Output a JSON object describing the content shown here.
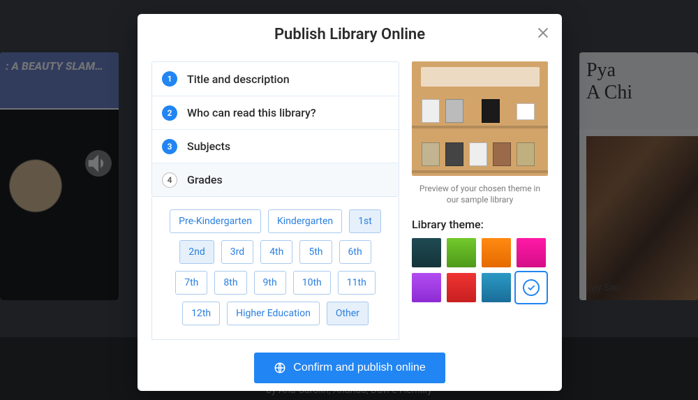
{
  "background": {
    "left_card": {
      "banner": ": A BEAUTY SLAM…"
    },
    "right_card": {
      "title_line1": "Pya",
      "title_line2": "A Chi",
      "author": "Lyly San"
    },
    "bottom_caption": "by Ana Carolin, Ananda, Davi e Hemilly"
  },
  "modal": {
    "title": "Publish Library Online",
    "steps": [
      {
        "num": "1",
        "label": "Title and description",
        "active": false,
        "done": true
      },
      {
        "num": "2",
        "label": "Who can read this library?",
        "active": false,
        "done": true
      },
      {
        "num": "3",
        "label": "Subjects",
        "active": false,
        "done": true
      },
      {
        "num": "4",
        "label": "Grades",
        "active": true,
        "done": false
      }
    ],
    "grades": [
      {
        "label": "Pre-Kindergarten",
        "selected": false
      },
      {
        "label": "Kindergarten",
        "selected": false
      },
      {
        "label": "1st",
        "selected": true
      },
      {
        "label": "2nd",
        "selected": true
      },
      {
        "label": "3rd",
        "selected": false
      },
      {
        "label": "4th",
        "selected": false
      },
      {
        "label": "5th",
        "selected": false
      },
      {
        "label": "6th",
        "selected": false
      },
      {
        "label": "7th",
        "selected": false
      },
      {
        "label": "8th",
        "selected": false
      },
      {
        "label": "9th",
        "selected": false
      },
      {
        "label": "10th",
        "selected": false
      },
      {
        "label": "11th",
        "selected": false
      },
      {
        "label": "12th",
        "selected": false
      },
      {
        "label": "Higher Education",
        "selected": false
      },
      {
        "label": "Other",
        "selected": true
      }
    ],
    "preview_caption": "Preview of your chosen theme in our sample library",
    "theme_label": "Library theme:",
    "themes": [
      {
        "name": "teal-dark",
        "css": "linear-gradient(#1f4a52,#14343a)",
        "selected": false
      },
      {
        "name": "green",
        "css": "linear-gradient(#72c92b,#4e9a1a)",
        "selected": false
      },
      {
        "name": "orange",
        "css": "linear-gradient(#ff8a12,#e56a00)",
        "selected": false
      },
      {
        "name": "magenta",
        "css": "linear-gradient(#ff1aa6,#d50d88)",
        "selected": false
      },
      {
        "name": "purple",
        "css": "linear-gradient(#b24cf0,#8d2cd4)",
        "selected": false
      },
      {
        "name": "red",
        "css": "linear-gradient(#ef3434,#c81f1f)",
        "selected": false
      },
      {
        "name": "blue",
        "css": "linear-gradient(#2a9ac4,#1a6d9a)",
        "selected": false
      },
      {
        "name": "wood",
        "css": "#ffffff",
        "selected": true
      }
    ],
    "confirm_label": "Confirm and publish online"
  }
}
